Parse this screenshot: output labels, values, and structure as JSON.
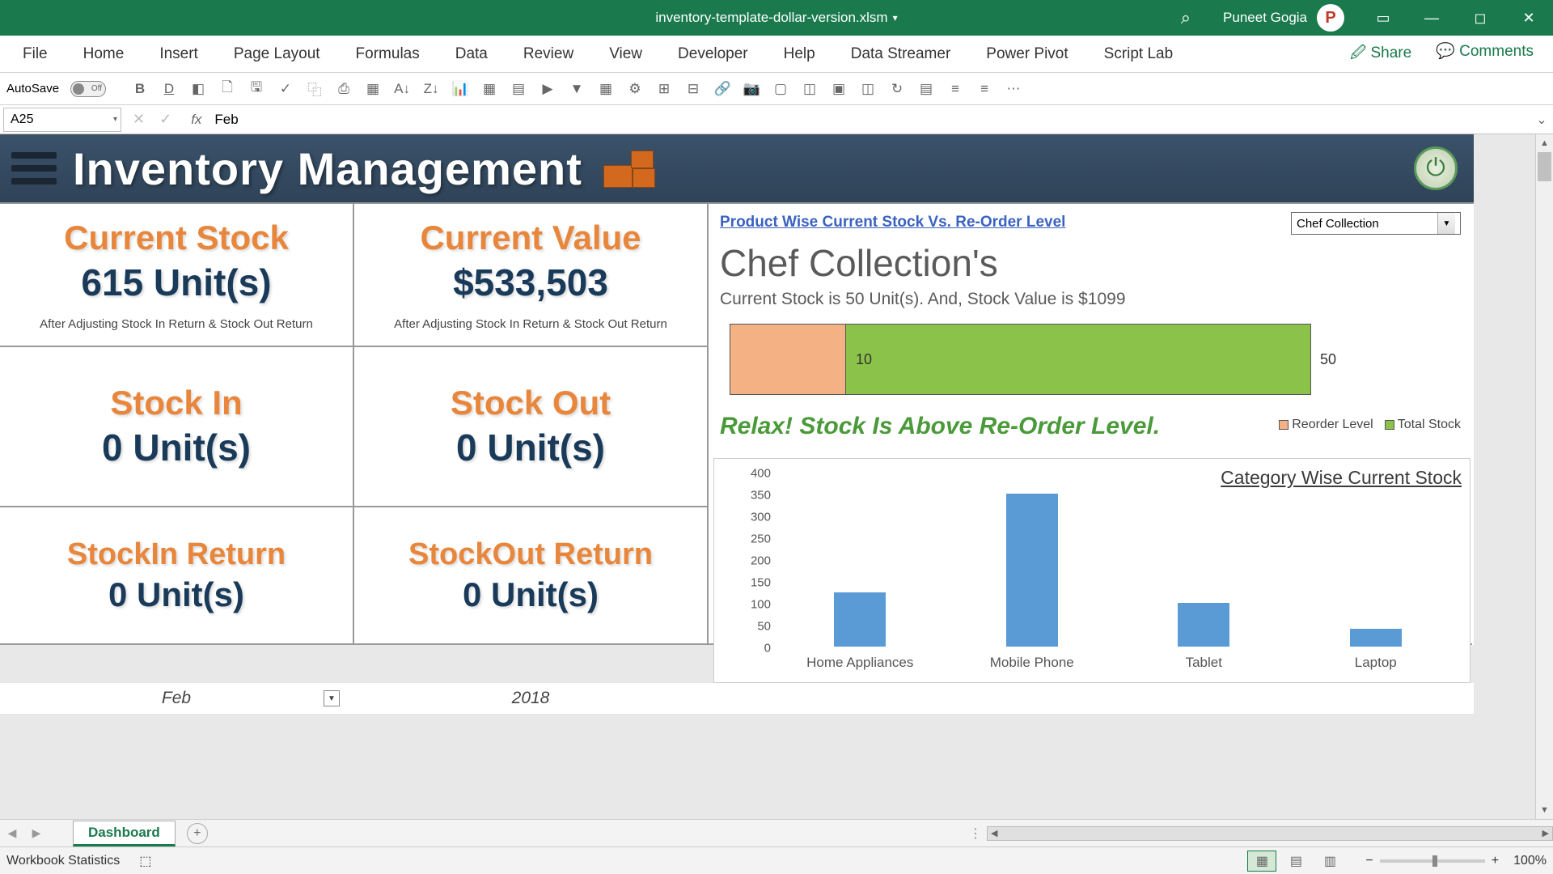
{
  "title": {
    "filename": "inventory-template-dollar-version.xlsm",
    "user": "Puneet Gogia",
    "avatar_initial": "P"
  },
  "ribbon": [
    "File",
    "Home",
    "Insert",
    "Page Layout",
    "Formulas",
    "Data",
    "Review",
    "View",
    "Developer",
    "Help",
    "Data Streamer",
    "Power Pivot",
    "Script Lab"
  ],
  "share": "Share",
  "comments": "Comments",
  "autosave": {
    "label": "AutoSave",
    "state": "Off"
  },
  "namebox": "A25",
  "formula": "Feb",
  "dash_title": "Inventory Management",
  "cards": {
    "stock": {
      "h": "Current Stock",
      "v": "615 Unit(s)",
      "s": "After Adjusting Stock In Return & Stock Out Return"
    },
    "value": {
      "h": "Current Value",
      "v": "$533,503",
      "s": "After Adjusting Stock In Return & Stock Out Return"
    },
    "in": {
      "h": "Stock In",
      "v": "0 Unit(s)"
    },
    "out": {
      "h": "Stock Out",
      "v": "0 Unit(s)"
    },
    "inret": {
      "h": "StockIn Return",
      "v": "0 Unit(s)"
    },
    "outret": {
      "h": "StockOut Return",
      "v": "0 Unit(s)"
    }
  },
  "product": {
    "title": "Product Wise Current Stock Vs. Re-Order Level",
    "select": "Chef Collection",
    "name": "Chef Collection's",
    "sub": "Current Stock is 50 Unit(s). And, Stock Value is $1099",
    "reorder_label": "10",
    "stock_label": "50",
    "status": "Relax! Stock Is Above Re-Order Level.",
    "legend_reorder": "Reorder Level",
    "legend_total": "Total Stock"
  },
  "daterow": {
    "month": "Feb",
    "year": "2018"
  },
  "tabs": {
    "dashboard": "Dashboard"
  },
  "status": {
    "label": "Workbook Statistics",
    "zoom": "100%"
  },
  "chart_data": {
    "type": "bar",
    "title": "Category Wise Current Stock",
    "ylim": [
      0,
      400
    ],
    "yticks": [
      0,
      50,
      100,
      150,
      200,
      250,
      300,
      350,
      400
    ],
    "categories": [
      "Home Appliances",
      "Mobile Phone",
      "Tablet",
      "Laptop"
    ],
    "values": [
      125,
      350,
      100,
      40
    ]
  }
}
